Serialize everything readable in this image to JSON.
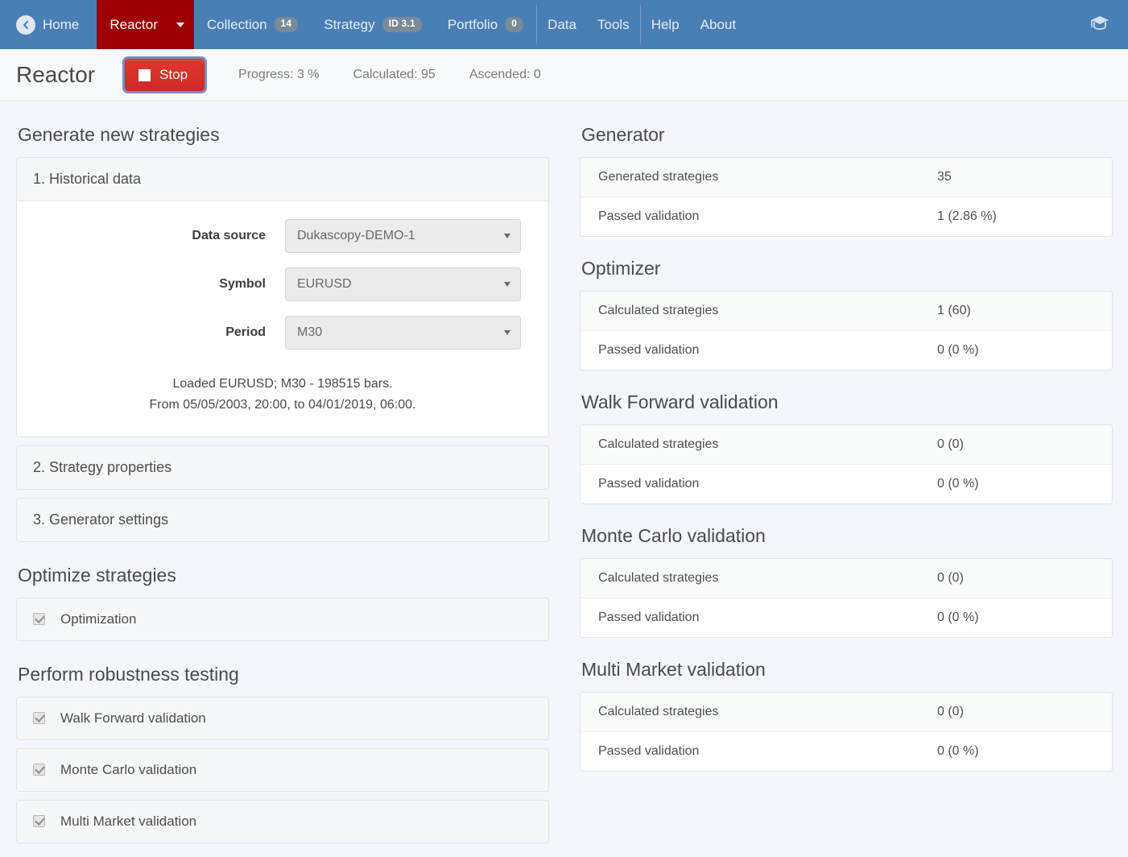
{
  "navbar": {
    "back_icon": "back-circle-arrow-icon",
    "home_label": "Home",
    "items": [
      {
        "label": "Reactor",
        "badge": null,
        "active": true,
        "caret": true
      },
      {
        "label": "Collection",
        "badge": "14",
        "active": false,
        "caret": false
      },
      {
        "label": "Strategy",
        "badge": "ID 3.1",
        "active": false,
        "caret": false
      },
      {
        "label": "Portfolio",
        "badge": "0",
        "active": false,
        "caret": false
      }
    ],
    "group2": [
      {
        "label": "Data"
      },
      {
        "label": "Tools"
      }
    ],
    "group3": [
      {
        "label": "Help"
      },
      {
        "label": "About"
      }
    ],
    "right_icon": "graduation-cap-icon"
  },
  "toolbar": {
    "title": "Reactor",
    "stop_label": "Stop",
    "progress": "Progress: 3 %",
    "calculated": "Calculated: 95",
    "ascended": "Ascended: 0"
  },
  "left": {
    "generate_heading": "Generate new strategies",
    "panels": [
      {
        "title": "1. Historical data"
      },
      {
        "title": "2. Strategy properties"
      },
      {
        "title": "3. Generator settings"
      }
    ],
    "historical": {
      "fields": [
        {
          "label": "Data source",
          "value": "Dukascopy-DEMO-1"
        },
        {
          "label": "Symbol",
          "value": "EURUSD"
        },
        {
          "label": "Period",
          "value": "M30"
        }
      ],
      "loaded_line1": "Loaded EURUSD; M30 - 198515 bars.",
      "loaded_line2": "From 05/05/2003, 20:00, to 04/01/2019, 06:00."
    },
    "optimize_heading": "Optimize strategies",
    "optimize_items": [
      {
        "label": "Optimization",
        "checked": true
      }
    ],
    "robustness_heading": "Perform robustness testing",
    "robustness_items": [
      {
        "label": "Walk Forward validation",
        "checked": true
      },
      {
        "label": "Monte Carlo validation",
        "checked": true
      },
      {
        "label": "Multi Market validation",
        "checked": true
      }
    ]
  },
  "right": {
    "sections": [
      {
        "heading": "Generator",
        "rows": [
          {
            "key": "Generated strategies",
            "value": "35"
          },
          {
            "key": "Passed validation",
            "value": "1 (2.86 %)"
          }
        ]
      },
      {
        "heading": "Optimizer",
        "rows": [
          {
            "key": "Calculated strategies",
            "value": "1 (60)"
          },
          {
            "key": "Passed validation",
            "value": "0 (0 %)"
          }
        ]
      },
      {
        "heading": "Walk Forward validation",
        "rows": [
          {
            "key": "Calculated strategies",
            "value": "0 (0)"
          },
          {
            "key": "Passed validation",
            "value": "0 (0 %)"
          }
        ]
      },
      {
        "heading": "Monte Carlo validation",
        "rows": [
          {
            "key": "Calculated strategies",
            "value": "0 (0)"
          },
          {
            "key": "Passed validation",
            "value": "0 (0 %)"
          }
        ]
      },
      {
        "heading": "Multi Market validation",
        "rows": [
          {
            "key": "Calculated strategies",
            "value": "0 (0)"
          },
          {
            "key": "Passed validation",
            "value": "0 (0 %)"
          }
        ]
      }
    ]
  },
  "colors": {
    "navbar": "#4a7fb5",
    "active_tab": "#9e0101",
    "stop_button": "#d72f29",
    "page_bg": "#f3f7fb"
  }
}
